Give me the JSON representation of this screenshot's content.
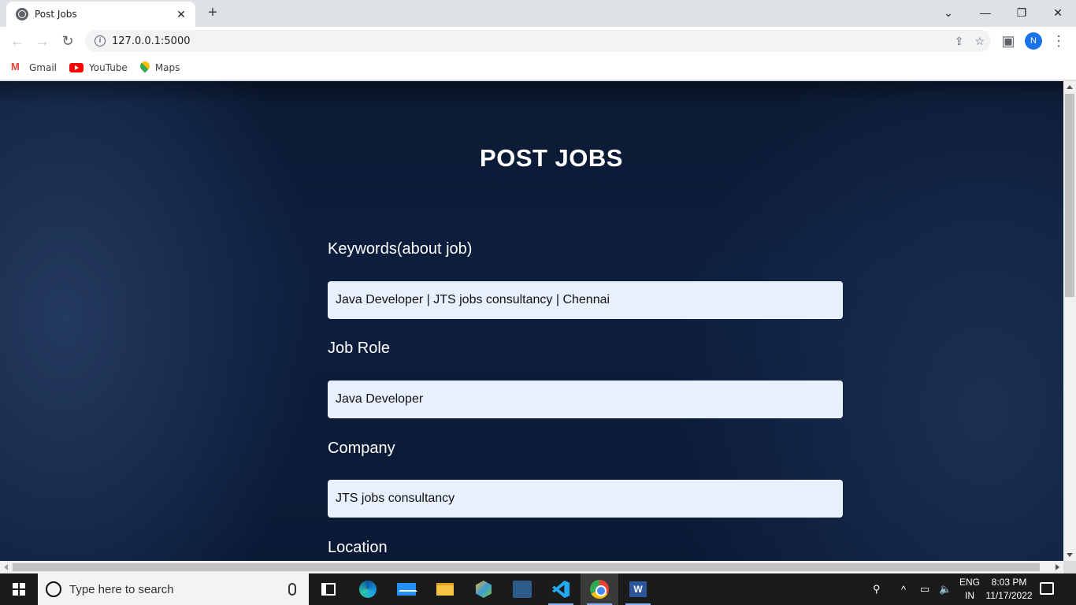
{
  "browser": {
    "tab": {
      "title": "Post Jobs",
      "close": "✕"
    },
    "new_tab": "+",
    "window_controls": {
      "dropdown": "⌄",
      "minimize": "—",
      "restore": "❐",
      "close": "✕"
    },
    "nav": {
      "back": "←",
      "forward": "→",
      "reload": "↻"
    },
    "url": "127.0.0.1:5000",
    "profile_initial": "N",
    "bookmarks": [
      {
        "label": "Gmail",
        "icon": "gmail-icon"
      },
      {
        "label": "YouTube",
        "icon": "youtube-icon"
      },
      {
        "label": "Maps",
        "icon": "maps-icon"
      }
    ]
  },
  "page": {
    "title": "POST JOBS",
    "fields": [
      {
        "label": "Keywords(about job)",
        "value": "Java Developer | JTS jobs consultancy | Chennai"
      },
      {
        "label": "Job Role",
        "value": "Java Developer"
      },
      {
        "label": "Company",
        "value": "JTS jobs consultancy"
      },
      {
        "label": "Location",
        "value": ""
      }
    ]
  },
  "taskbar": {
    "search_placeholder": "Type here to search",
    "language": [
      "ENG",
      "IN"
    ],
    "time": "8:03 PM",
    "date": "11/17/2022"
  },
  "colors": {
    "page_bg": "#0d1f3d",
    "input_bg": "#e8f0fe",
    "accent": "#1a73e8"
  }
}
